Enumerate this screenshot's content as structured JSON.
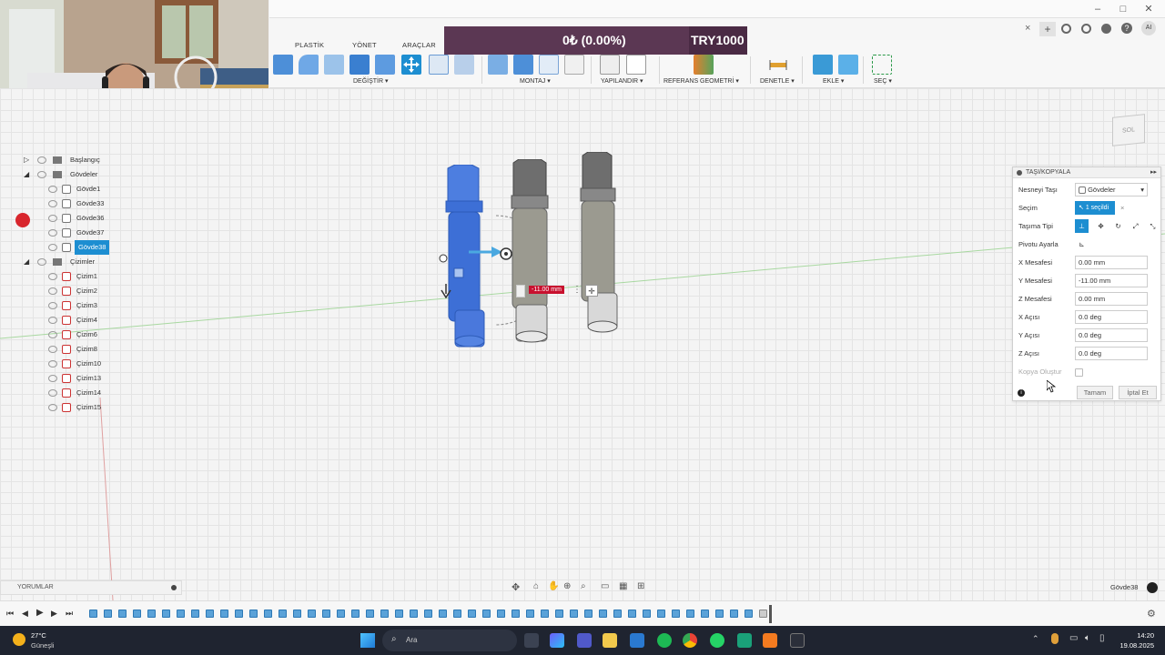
{
  "toolbar": {
    "tabs": [
      "PLASTİK",
      "YÖNET",
      "ARAÇLAR"
    ],
    "groups": [
      "DEĞİŞTİR",
      "MONTAJ",
      "YAPILANDIR",
      "REFERANS GEOMETRİ",
      "DENETLE",
      "EKLE",
      "SEÇ"
    ]
  },
  "overlay": {
    "progress": "0₺ (0.00%)",
    "goal": "TRY1000"
  },
  "browser": {
    "items": [
      {
        "label": "Başlangıç"
      },
      {
        "label": "Gövdeler"
      },
      {
        "label": "Gövde1"
      },
      {
        "label": "Gövde33"
      },
      {
        "label": "Gövde36"
      },
      {
        "label": "Gövde37"
      },
      {
        "label": "Gövde38"
      },
      {
        "label": "Çizimler"
      },
      {
        "label": "Çizim1"
      },
      {
        "label": "Çizim2"
      },
      {
        "label": "Çizim3"
      },
      {
        "label": "Çizim4"
      },
      {
        "label": "Çizim6"
      },
      {
        "label": "Çizim8"
      },
      {
        "label": "Çizim10"
      },
      {
        "label": "Çizim13"
      },
      {
        "label": "Çizim14"
      },
      {
        "label": "Çizim15"
      }
    ]
  },
  "viewport": {
    "dim_value": "-11.00 mm",
    "viewcube": "SOL"
  },
  "panel": {
    "title": "TAŞI/KOPYALA",
    "move_object_label": "Nesneyi Taşı",
    "move_object_value": "Gövdeler",
    "selection_label": "Seçim",
    "selection_value": "1 seçildi",
    "move_type_label": "Taşıma Tipi",
    "pivot_label": "Pivotu Ayarla",
    "x_dist_label": "X Mesafesi",
    "x_dist": "0.00 mm",
    "y_dist_label": "Y Mesafesi",
    "y_dist": "-11.00 mm",
    "z_dist_label": "Z Mesafesi",
    "z_dist": "0.00 mm",
    "x_angle_label": "X Açısı",
    "x_angle": "0.0 deg",
    "y_angle_label": "Y Açısı",
    "y_angle": "0.0 deg",
    "z_angle_label": "Z Açısı",
    "z_angle": "0.0 deg",
    "copy_label": "Kopya Oluştur",
    "ok": "Tamam",
    "cancel": "İptal Et"
  },
  "comments_label": "YORUMLAR",
  "status_body": "Gövde38",
  "taskbar": {
    "weather_temp": "27°C",
    "weather_desc": "Güneşli",
    "search": "Ara",
    "time": "14:20",
    "date": "19.08.2025"
  },
  "colors": {
    "accent": "#1d8ed1",
    "body_blue": "#3d6fd6",
    "overlay": "#5b3753"
  }
}
